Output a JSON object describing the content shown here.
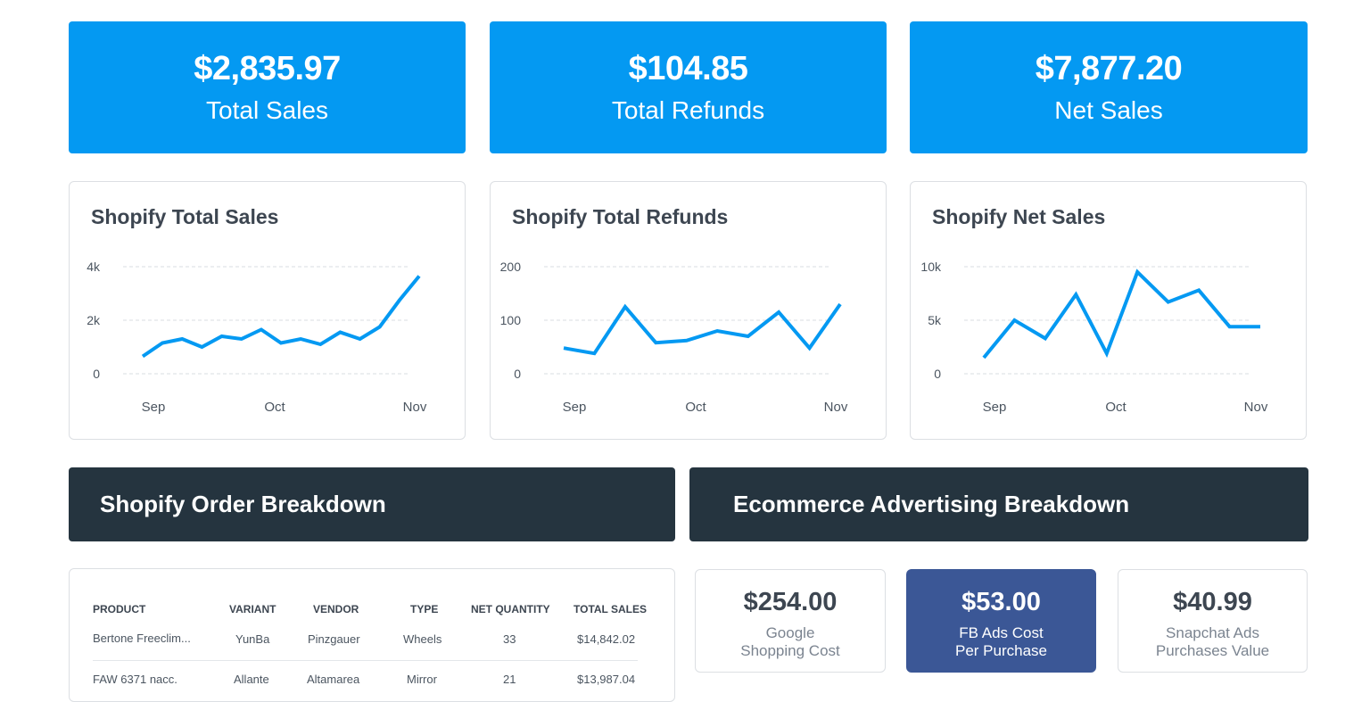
{
  "kpis": [
    {
      "value": "$2,835.97",
      "label": "Total Sales"
    },
    {
      "value": "$104.85",
      "label": "Total Refunds"
    },
    {
      "value": "$7,877.20",
      "label": "Net Sales"
    }
  ],
  "colors": {
    "accent": "#0499f2",
    "band": "#25343f",
    "highlight": "#3b5796"
  },
  "chart_data": [
    {
      "type": "line",
      "title": "Shopify Total Sales",
      "y_ticks": [
        "4k",
        "2k",
        "0"
      ],
      "x_ticks": [
        "Sep",
        "Oct",
        "Nov"
      ],
      "ylim": [
        0,
        4000
      ],
      "grid": true,
      "x": [
        1,
        2,
        3,
        4,
        5,
        6,
        7,
        8,
        9,
        10,
        11,
        12,
        13,
        14,
        15
      ],
      "values": [
        650,
        1150,
        1300,
        1000,
        1400,
        1300,
        1650,
        1150,
        1300,
        1100,
        1550,
        1300,
        1750,
        2750,
        3650
      ]
    },
    {
      "type": "line",
      "title": "Shopify Total Refunds",
      "y_ticks": [
        "200",
        "100",
        "0"
      ],
      "x_ticks": [
        "Sep",
        "Oct",
        "Nov"
      ],
      "ylim": [
        0,
        200
      ],
      "grid": true,
      "x": [
        1,
        2,
        3,
        4,
        5,
        6,
        7,
        8,
        9,
        10,
        11,
        12
      ],
      "values": [
        48,
        38,
        125,
        58,
        62,
        80,
        70,
        115,
        48,
        130
      ]
    },
    {
      "type": "line",
      "title": "Shopify Net Sales",
      "y_ticks": [
        "10k",
        "5k",
        "0"
      ],
      "x_ticks": [
        "Sep",
        "Oct",
        "Nov"
      ],
      "ylim": [
        0,
        10000
      ],
      "grid": true,
      "x": [
        1,
        2,
        3,
        4,
        5,
        6,
        7,
        8,
        9,
        10
      ],
      "values": [
        1500,
        5000,
        3300,
        7400,
        1900,
        9500,
        6700,
        7800,
        4400,
        4400
      ]
    }
  ],
  "bands": {
    "orders": "Shopify Order Breakdown",
    "ads": "Ecommerce Advertising Breakdown"
  },
  "table": {
    "headers": [
      "PRODUCT",
      "VARIANT",
      "VENDOR",
      "TYPE",
      "NET QUANTITY",
      "TOTAL SALES"
    ],
    "rows": [
      [
        "Bertone Freeclim...",
        "YunBa",
        "Pinzgauer",
        "Wheels",
        "33",
        "$14,842.02"
      ],
      [
        "FAW 6371 nacc.",
        "Allante",
        "Altamarea",
        "Mirror",
        "21",
        "$13,987.04"
      ]
    ]
  },
  "metrics": [
    {
      "value": "$254.00",
      "line1": "Google",
      "line2": "Shopping Cost"
    },
    {
      "value": "$53.00",
      "line1": "FB Ads Cost",
      "line2": "Per Purchase"
    },
    {
      "value": "$40.99",
      "line1": "Snapchat Ads",
      "line2": "Purchases Value"
    }
  ]
}
